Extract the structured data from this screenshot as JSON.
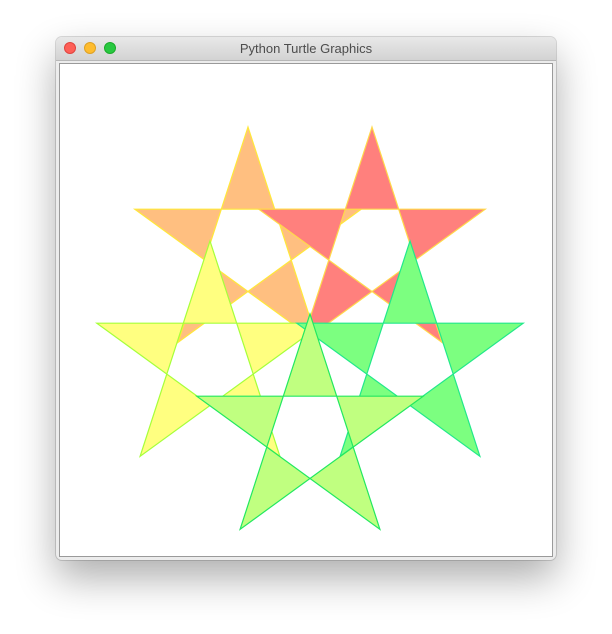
{
  "window": {
    "title": "Python Turtle Graphics"
  },
  "colors": {
    "close": "#fe5f57",
    "minimize": "#febc2e",
    "maximize": "#28c840"
  },
  "drawing": {
    "shape": "five-pointed star",
    "stars": [
      {
        "name": "star-top-left",
        "fill": "#ffbf80",
        "pen": "#ffe83a"
      },
      {
        "name": "star-top-right",
        "fill": "#ff807d",
        "pen": "#ffd94a"
      },
      {
        "name": "star-middle-left",
        "fill": "#ffff80",
        "pen": "#a6ff3a"
      },
      {
        "name": "star-middle-right",
        "fill": "#7cff80",
        "pen": "#22e88a"
      },
      {
        "name": "star-bottom",
        "fill": "#c0ff80",
        "pen": "#22e860"
      }
    ]
  }
}
